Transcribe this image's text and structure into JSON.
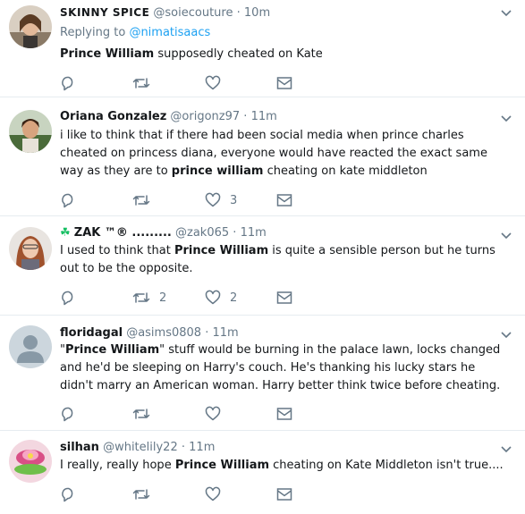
{
  "tweets": [
    {
      "name": "SKINNY SPICE",
      "handle": "@soiecouture",
      "dot": "·",
      "time": "10m",
      "replying_label": "Replying to",
      "replying_to": "@nimatisaacs",
      "text_bold": "Prince William",
      "text_rest": " supposedly cheated on Kate",
      "reply_count": "",
      "retweet_count": "",
      "like_count": ""
    },
    {
      "name": "Oriana Gonzalez",
      "handle": "@origonz97",
      "dot": "·",
      "time": "11m",
      "text_a": "i like to think that if there had been social media when prince charles cheated on princess diana, everyone would have reacted the exact same way as they are to ",
      "text_bold": "prince william",
      "text_rest": " cheating on kate middleton",
      "reply_count": "",
      "retweet_count": "",
      "like_count": "3"
    },
    {
      "name_prefix": "☘",
      "name": "ZAK ™® .........",
      "handle": "@zak065",
      "dot": "·",
      "time": "11m",
      "text_a": "I used to think that ",
      "text_bold": "Prince William",
      "text_rest": " is quite a sensible person but he turns out to be the opposite.",
      "reply_count": "",
      "retweet_count": "2",
      "like_count": "2"
    },
    {
      "name": "floridagal",
      "handle": "@asims0808",
      "dot": "·",
      "time": "11m",
      "text_a": "\"",
      "text_bold": "Prince William",
      "text_rest": "\" stuff would be burning in the palace lawn, locks changed and he'd be sleeping on Harry's couch.  He's thanking his lucky stars he didn't marry an American woman.    Harry better think twice before cheating.",
      "reply_count": "",
      "retweet_count": "",
      "like_count": ""
    },
    {
      "name": "silhan",
      "handle": "@whitelily22",
      "dot": "·",
      "time": "11m",
      "text_a": "I really, really hope ",
      "text_bold": "Prince William",
      "text_rest": " cheating on Kate Middleton isn't true....",
      "reply_count": "",
      "retweet_count": "",
      "like_count": ""
    }
  ],
  "colors": {
    "text": "#14171a",
    "secondary": "#657786",
    "link": "#1da1f2",
    "border": "#e6ecf0"
  },
  "icons": [
    "reply-icon",
    "retweet-icon",
    "like-icon",
    "message-icon",
    "chevron-down-icon",
    "shamrock-icon"
  ]
}
